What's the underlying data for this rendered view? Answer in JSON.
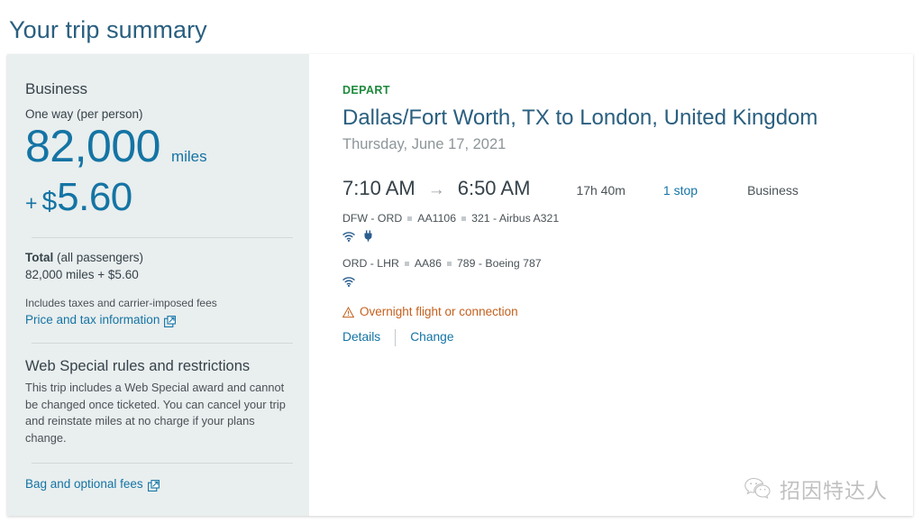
{
  "page": {
    "title": "Your trip summary"
  },
  "summary": {
    "cabin": "Business",
    "fare_type": "One way (per person)",
    "miles_amount": "82,000",
    "miles_unit": "miles",
    "cash_plus": "+",
    "cash_sign": "$",
    "cash_amount": "5.60",
    "total_label_bold": "Total",
    "total_label_rest": " (all passengers)",
    "total_value": "82,000 miles + $5.60",
    "fees_note": "Includes taxes and carrier-imposed fees",
    "price_tax_link": "Price and tax information",
    "price_tax_icon": "external-link-icon",
    "rules_title": "Web Special rules and restrictions",
    "rules_body": "This trip includes a Web Special award and cannot be changed once ticketed. You can cancel your trip and reinstate miles at no charge if your plans change.",
    "bag_fees_link": "Bag and optional fees",
    "bag_fees_icon": "external-link-icon",
    "accent_color": "#1474a4",
    "panel_bg": "#e9eeee"
  },
  "itinerary": {
    "depart_tag": "DEPART",
    "depart_tag_color": "#1e8a3c",
    "route": "Dallas/Fort Worth, TX to London, United Kingdom",
    "date": "Thursday, June 17, 2021",
    "depart_time": "7:10 AM",
    "arrow": "→",
    "arrive_time": "6:50 AM",
    "duration": "17h 40m",
    "stops": "1 stop",
    "cabin": "Business",
    "segments": [
      {
        "route": "DFW - ORD",
        "flight_number": "AA1106",
        "equipment": "321 - Airbus A321",
        "amenities": [
          "wifi-icon",
          "power-outlet-icon"
        ]
      },
      {
        "route": "ORD - LHR",
        "flight_number": "AA86",
        "equipment": "789 - Boeing 787",
        "amenities": [
          "wifi-icon"
        ]
      }
    ],
    "overnight_warning": "Overnight flight or connection",
    "overnight_icon": "warning-triangle-icon",
    "overnight_color": "#c4601d",
    "details_link": "Details",
    "change_link": "Change"
  },
  "watermark": {
    "logo": "wechat-icon",
    "text": "招因特达人"
  }
}
